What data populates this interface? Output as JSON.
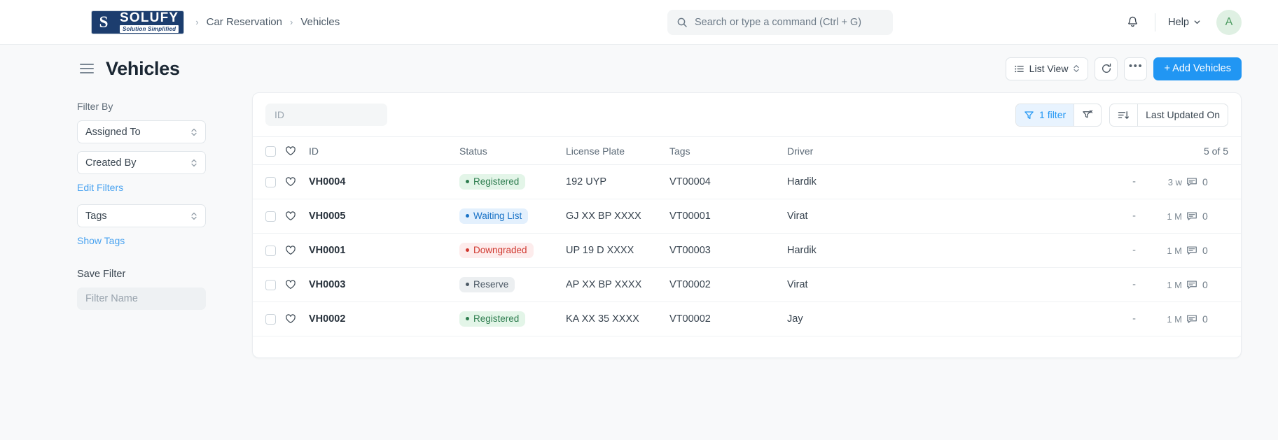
{
  "navbar": {
    "brand": {
      "mark": "S",
      "name": "SOLUFY",
      "tagline": "Solution Simplified"
    },
    "breadcrumbs": [
      {
        "sep": "›",
        "label": "Car Reservation"
      },
      {
        "sep": "›",
        "label": "Vehicles"
      }
    ],
    "search": {
      "placeholder": "Search or type a command (Ctrl + G)",
      "value": ""
    },
    "help_label": "Help",
    "avatar_initial": "A"
  },
  "page": {
    "title": "Vehicles",
    "actions": {
      "view_label": "List View",
      "refresh_label": "",
      "more_label": "•••",
      "add_label": "+ Add Vehicles"
    }
  },
  "sidebar": {
    "filter_by_label": "Filter By",
    "filters": [
      {
        "label": "Assigned To"
      },
      {
        "label": "Created By"
      }
    ],
    "edit_filters_label": "Edit Filters",
    "tags_filter": {
      "label": "Tags"
    },
    "show_tags_label": "Show Tags",
    "save_filter_label": "Save Filter",
    "filter_name_placeholder": "Filter Name",
    "filter_name_value": ""
  },
  "table": {
    "id_search_placeholder": "ID",
    "filter_count_label": "1 filter",
    "sort_label": "Last Updated On",
    "result_count": "5 of 5",
    "columns": [
      {
        "key": "id",
        "label": "ID"
      },
      {
        "key": "status",
        "label": "Status"
      },
      {
        "key": "plate",
        "label": "License Plate"
      },
      {
        "key": "tags",
        "label": "Tags"
      },
      {
        "key": "driver",
        "label": "Driver"
      }
    ],
    "rows": [
      {
        "id": "VH0004",
        "status": "Registered",
        "status_type": "green",
        "plate": "192 UYP",
        "tags": "VT00004",
        "driver": "Hardik",
        "dash": "-",
        "age": "3 w",
        "comments": "0"
      },
      {
        "id": "VH0005",
        "status": "Waiting List",
        "status_type": "blue",
        "plate": "GJ XX BP XXXX",
        "tags": "VT00001",
        "driver": "Virat",
        "dash": "-",
        "age": "1 M",
        "comments": "0"
      },
      {
        "id": "VH0001",
        "status": "Downgraded",
        "status_type": "red",
        "plate": "UP 19 D XXXX",
        "tags": "VT00003",
        "driver": "Hardik",
        "dash": "-",
        "age": "1 M",
        "comments": "0"
      },
      {
        "id": "VH0003",
        "status": "Reserve",
        "status_type": "gray",
        "plate": "AP XX BP XXXX",
        "tags": "VT00002",
        "driver": "Virat",
        "dash": "-",
        "age": "1 M",
        "comments": "0"
      },
      {
        "id": "VH0002",
        "status": "Registered",
        "status_type": "green",
        "plate": "KA XX 35 XXXX",
        "tags": "VT00002",
        "driver": "Jay",
        "dash": "-",
        "age": "1 M",
        "comments": "0"
      }
    ]
  },
  "colors": {
    "brand_navy": "#1c3d6e",
    "accent_blue": "#2196f3",
    "link_blue": "#4aa3f0",
    "status_green_bg": "#e3f5e8",
    "status_green_fg": "#2e7d4f",
    "status_blue_bg": "#e3f0fd",
    "status_blue_fg": "#1a73c7",
    "status_red_bg": "#fdecec",
    "status_red_fg": "#d0382f",
    "status_gray_bg": "#eceff1",
    "status_gray_fg": "#4d5a66",
    "avatar_bg": "#dff0e3",
    "avatar_fg": "#4e9c62"
  }
}
